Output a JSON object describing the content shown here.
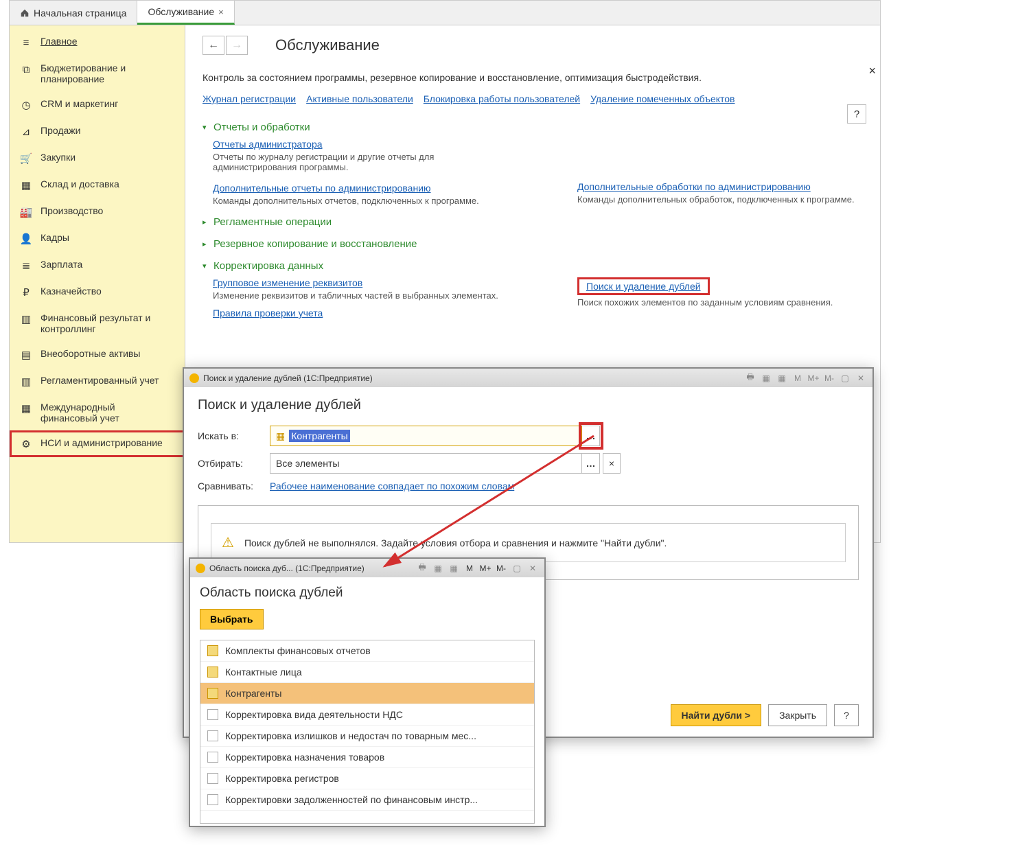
{
  "tabs": [
    {
      "label": "Начальная страница"
    },
    {
      "label": "Обслуживание"
    }
  ],
  "sidebar": {
    "items": [
      {
        "icon": "menu",
        "label": "Главное"
      },
      {
        "icon": "chart",
        "label": "Бюджетирование и планирование"
      },
      {
        "icon": "clock",
        "label": "CRM и маркетинг"
      },
      {
        "icon": "tag",
        "label": "Продажи"
      },
      {
        "icon": "cart",
        "label": "Закупки"
      },
      {
        "icon": "boxes",
        "label": "Склад и доставка"
      },
      {
        "icon": "factory",
        "label": "Производство"
      },
      {
        "icon": "person",
        "label": "Кадры"
      },
      {
        "icon": "list",
        "label": "Зарплата"
      },
      {
        "icon": "ruble",
        "label": "Казначейство"
      },
      {
        "icon": "barchart",
        "label": "Финансовый результат и контроллинг"
      },
      {
        "icon": "asset",
        "label": "Внеоборотные активы"
      },
      {
        "icon": "doc",
        "label": "Регламентированный учет"
      },
      {
        "icon": "globe",
        "label": "Международный финансовый учет"
      },
      {
        "icon": "gear",
        "label": "НСИ и администрирование"
      }
    ]
  },
  "page": {
    "title": "Обслуживание",
    "desc": "Контроль за состоянием программы, резервное копирование и восстановление, оптимизация быстродействия.",
    "help": "?",
    "top_links": [
      "Журнал регистрации",
      "Активные пользователи",
      "Блокировка работы пользователей",
      "Удаление помеченных объектов"
    ],
    "s1": {
      "title": "Отчеты и обработки",
      "l1": "Отчеты администратора",
      "d1": "Отчеты по журналу регистрации и другие отчеты для администрирования программы.",
      "l2": "Дополнительные отчеты по администрированию",
      "d2": "Команды дополнительных отчетов, подключенных к программе.",
      "l3": "Дополнительные обработки по администрированию",
      "d3": "Команды дополнительных обработок, подключенных к программе."
    },
    "s2": {
      "title": "Регламентные операции"
    },
    "s3": {
      "title": "Резервное копирование и восстановление"
    },
    "s4": {
      "title": "Корректировка данных",
      "l1": "Групповое изменение реквизитов",
      "d1": "Изменение реквизитов и табличных частей в выбранных элементах.",
      "l2": "Поиск и удаление дублей",
      "d2": "Поиск похожих элементов по заданным условиям сравнения.",
      "l3": "Правила проверки учета"
    }
  },
  "win1": {
    "titlebar": "Поиск и удаление дублей  (1С:Предприятие)",
    "titlebar_icons": [
      "M",
      "M+",
      "M-"
    ],
    "title": "Поиск и удаление дублей",
    "search_label": "Искать в:",
    "search_value": "Контрагенты",
    "filter_label": "Отбирать:",
    "filter_value": "Все элементы",
    "compare_label": "Сравнивать:",
    "compare_link": "Рабочее наименование совпадает по похожим словам",
    "status": "Поиск дублей не выполнялся.  Задайте условия отбора и сравнения и нажмите \"Найти дубли\".",
    "find_btn": "Найти дубли >",
    "close_btn": "Закрыть",
    "help_btn": "?"
  },
  "win2": {
    "titlebar": "Область поиска дуб...  (1С:Предприятие)",
    "titlebar_icons": [
      "M",
      "M+",
      "M-"
    ],
    "title": "Область поиска дублей",
    "select_btn": "Выбрать",
    "items": [
      {
        "label": "Комплекты финансовых отчетов",
        "yellow": true
      },
      {
        "label": "Контактные лица",
        "yellow": true
      },
      {
        "label": "Контрагенты",
        "yellow": true,
        "selected": true
      },
      {
        "label": "Корректировка вида деятельности НДС"
      },
      {
        "label": "Корректировка излишков и недостач по товарным мес..."
      },
      {
        "label": "Корректировка назначения товаров"
      },
      {
        "label": "Корректировка регистров"
      },
      {
        "label": "Корректировки задолженностей по финансовым инстр..."
      }
    ]
  },
  "icon_glyphs": {
    "menu": "≡",
    "chart": "⧉",
    "clock": "◷",
    "tag": "⊿",
    "cart": "🛒",
    "boxes": "▦",
    "factory": "🏭",
    "person": "👤",
    "list": "≣",
    "ruble": "₽",
    "barchart": "▥",
    "asset": "▤",
    "doc": "▥",
    "globe": "▦",
    "gear": "⚙"
  }
}
